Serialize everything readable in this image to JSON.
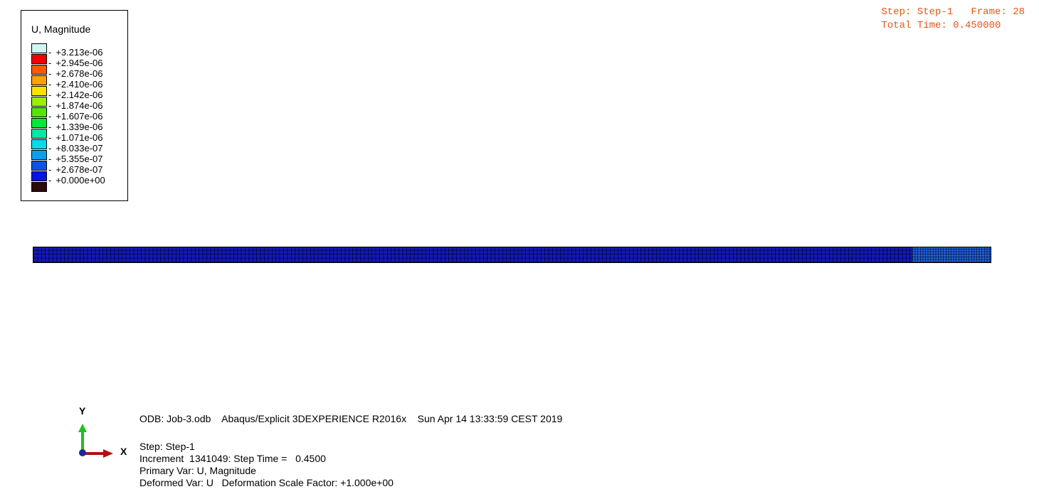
{
  "legend": {
    "title": "U, Magnitude",
    "labels": [
      "+3.213e-06",
      "+2.945e-06",
      "+2.678e-06",
      "+2.410e-06",
      "+2.142e-06",
      "+1.874e-06",
      "+1.607e-06",
      "+1.339e-06",
      "+1.071e-06",
      "+8.033e-07",
      "+5.355e-07",
      "+2.678e-07",
      "+0.000e+00"
    ],
    "colors": [
      "#cff6f6",
      "#ee0000",
      "#ff5a00",
      "#ffa000",
      "#ffe000",
      "#9af000",
      "#55e600",
      "#00e83a",
      "#00e8a2",
      "#00dcea",
      "#0aa0f0",
      "#0a55e8",
      "#0a14e0",
      "#2a0a0a"
    ]
  },
  "status": {
    "line1": "Step: Step-1   Frame: 28",
    "line2": "Total Time: 0.450000"
  },
  "triad": {
    "y_label": "Y",
    "x_label": "X",
    "y_color": "#1fbf1f",
    "x_color": "#b01010",
    "z_color": "#1a2a9a"
  },
  "info": {
    "odb_line": "ODB: Job-3.odb    Abaqus/Explicit 3DEXPERIENCE R2016x    Sun Apr 14 13:33:59 CEST 2019",
    "step_line": "Step: Step-1",
    "increment_line": "Increment  1341049: Step Time =   0.4500",
    "primary_var_line": "Primary Var: U, Magnitude",
    "deformed_var_line": "Deformed Var: U   Deformation Scale Factor: +1.000e+00"
  },
  "mesh": {
    "main_color": "#1419b6",
    "end_color": "#1f63d8"
  }
}
